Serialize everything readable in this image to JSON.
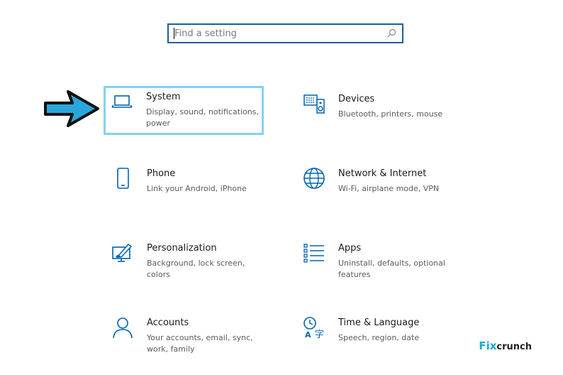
{
  "search": {
    "placeholder": "Find a setting",
    "value": ""
  },
  "settings": [
    {
      "id": "system",
      "title": "System",
      "description": "Display, sound, notifications, power",
      "icon": "laptop-icon",
      "selected": true
    },
    {
      "id": "devices",
      "title": "Devices",
      "description": "Bluetooth, printers, mouse",
      "icon": "devices-icon",
      "selected": false
    },
    {
      "id": "phone",
      "title": "Phone",
      "description": "Link your Android, iPhone",
      "icon": "phone-icon",
      "selected": false
    },
    {
      "id": "network",
      "title": "Network & Internet",
      "description": "Wi-Fi, airplane mode, VPN",
      "icon": "globe-icon",
      "selected": false
    },
    {
      "id": "personalization",
      "title": "Personalization",
      "description": "Background, lock screen, colors",
      "icon": "paint-monitor-icon",
      "selected": false
    },
    {
      "id": "apps",
      "title": "Apps",
      "description": "Uninstall, defaults, optional features",
      "icon": "apps-list-icon",
      "selected": false
    },
    {
      "id": "accounts",
      "title": "Accounts",
      "description": "Your accounts, email, sync, work, family",
      "icon": "person-icon",
      "selected": false
    },
    {
      "id": "time",
      "title": "Time & Language",
      "description": "Speech, region, date",
      "icon": "time-language-icon",
      "selected": false
    }
  ],
  "brand": {
    "part1": "Fix",
    "part2": "crunch"
  },
  "colors": {
    "accent": "#0063b1",
    "highlight": "#84d1f2",
    "arrow": "#2aa6dc",
    "search_border": "#1a5f9a"
  }
}
